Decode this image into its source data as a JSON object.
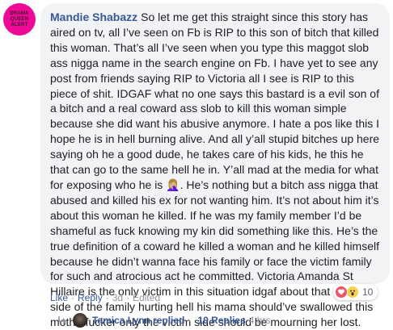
{
  "avatar": {
    "text": "DRAMA QUEEN ALERT",
    "color": "#ee0a94"
  },
  "comment": {
    "author": "Mandie Shabazz",
    "text": "So let me get this straight since this story has aired on tv, all I’ve seen on Fb is RIP to this son of bitch that killed this woman. That’s all I’ve seen when you type this maggot slob ass nigga name in the search engine on Fb. I have yet to see any post from friends saying RIP to Victoria all I see is RIP to this piece of shit. IDGAF what no one says this bastard is a evil son of a bitch and a real coward ass slob to kill this woman simple because she did want his abusive anymore. I hate a pos like this I hope he is in hell burning alive. And all y’all stupid bitches up here saying oh he a good dude, he takes care of his kids, he this he that can go to the same hell he in. Y’all mad at the media for what for exposing who he is 🤦🏼‍♀️. He’s nothing but a bitch ass nigga that abused and killed his ex for not wanting him. It’s not about him it’s about this woman he killed. If he was my family member I’d be shameful as fuck knowing my kin did something like this. He’s the true definition of a coward he killed a woman and he killed himself because he didn’t wanna face his family or face the victim family for such and atrocious act he committed. Victoria Amanda St Hillaire is the only victim in this situation idgaf about that coward side of the family hurting hell his mama should’ve swallowed this motherfucker only the victim side should be mourning her lost."
  },
  "reactions": {
    "icons": [
      "love-icon",
      "wow-icon"
    ],
    "count": "10"
  },
  "actions": {
    "like": "Like",
    "reply": "Reply",
    "time": "3d",
    "edited": "Edited",
    "separator": "·"
  },
  "replies": {
    "author": "Tamica Lynn",
    "verb": "replied",
    "separator": "·",
    "count": "10 Replies",
    "time": "4 hrs"
  },
  "colors": {
    "link": "#385898",
    "bubble": "#f2f3f5",
    "meta": "#90949c"
  }
}
